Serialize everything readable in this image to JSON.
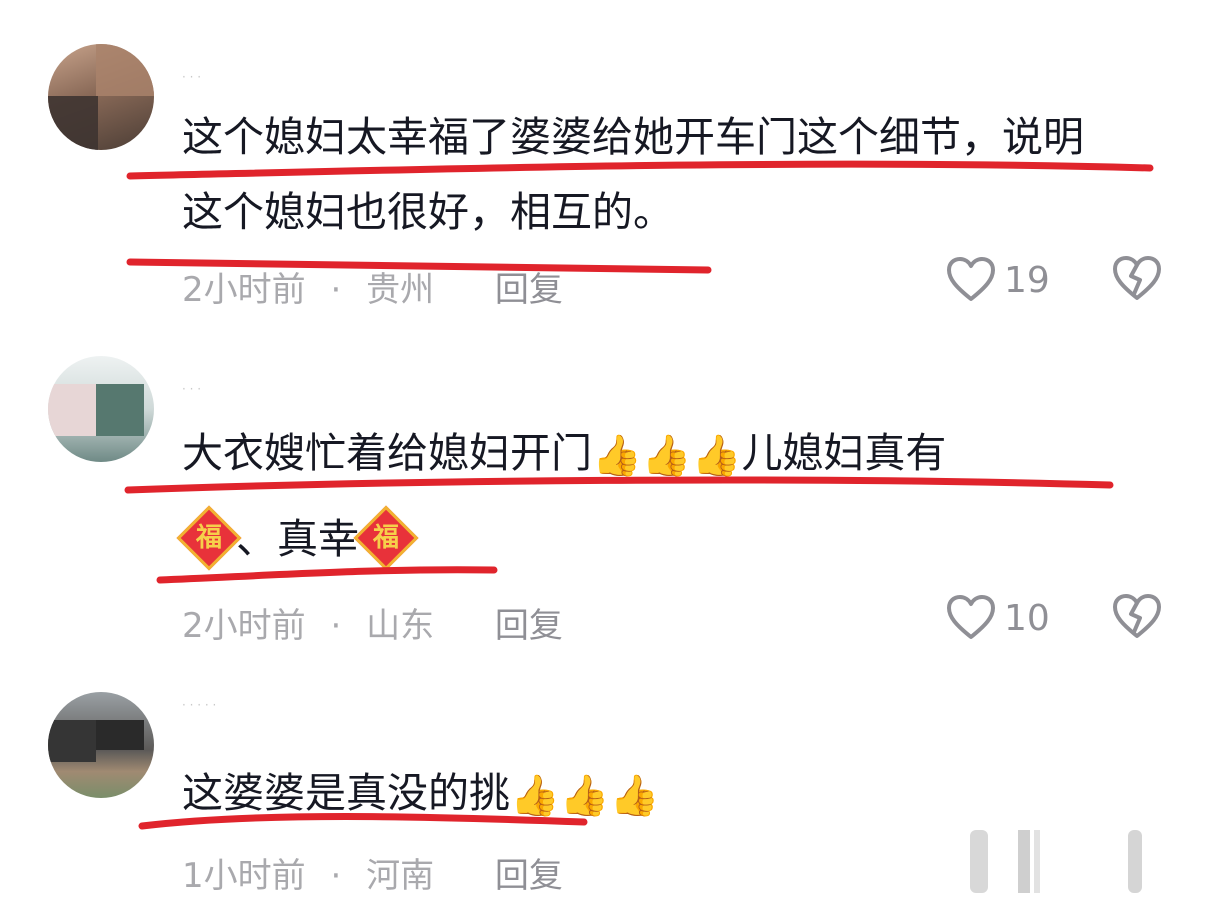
{
  "comments": [
    {
      "username": "· · ·",
      "text_line1": "这个媳妇太幸福了婆婆给她开车门这个细节，说明",
      "text_line2": "这个媳妇也很好，相互的。",
      "time": "2小时前",
      "location": "贵州",
      "reply_label": "回复",
      "likes": "19"
    },
    {
      "username": "· · ·",
      "text_part1": "大衣嫂忙着给媳妇开门",
      "thumbs": [
        "👍",
        "👍",
        "👍"
      ],
      "text_part2": "儿媳妇真有",
      "fu_char": "福",
      "text_line2_mid": "、真幸",
      "time": "2小时前",
      "location": "山东",
      "reply_label": "回复",
      "likes": "10"
    },
    {
      "username": "· · · · ·",
      "text_part1": "这婆婆是真没的挑",
      "thumbs": [
        "👍",
        "👍",
        "👍"
      ],
      "time": "1小时前",
      "location": "河南",
      "reply_label": "回复"
    }
  ],
  "meta_separator": "·",
  "icons": {
    "like": "heart-outline-icon",
    "dislike": "broken-heart-icon"
  },
  "colors": {
    "underline": "#e0242c",
    "meta": "#a9a9ad"
  }
}
